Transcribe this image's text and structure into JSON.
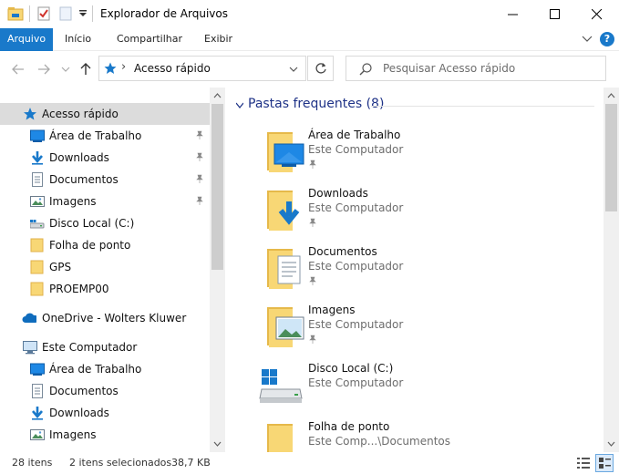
{
  "window": {
    "title": "Explorador de Arquivos",
    "controls": [
      "minimize-icon",
      "maximize-icon",
      "close-icon"
    ]
  },
  "ribbon": {
    "tabs": [
      {
        "label": "Arquivo",
        "active": true
      },
      {
        "label": "Início",
        "active": false
      },
      {
        "label": "Compartilhar",
        "active": false
      },
      {
        "label": "Exibir",
        "active": false
      }
    ],
    "help_label": "?"
  },
  "address": {
    "current": "Acesso rápido",
    "separator": "›"
  },
  "search": {
    "placeholder": "Pesquisar Acesso rápido"
  },
  "navigation": {
    "items": [
      {
        "label": "Acesso rápido",
        "icon": "star-icon",
        "pinned": false,
        "selected": true
      },
      {
        "label": "Área de Trabalho",
        "icon": "desktop-icon",
        "pinned": true
      },
      {
        "label": "Downloads",
        "icon": "download-icon",
        "pinned": true
      },
      {
        "label": "Documentos",
        "icon": "document-icon",
        "pinned": true
      },
      {
        "label": "Imagens",
        "icon": "pictures-icon",
        "pinned": true
      },
      {
        "label": "Disco Local (C:)",
        "icon": "drive-icon",
        "pinned": false
      },
      {
        "label": "Folha de ponto",
        "icon": "folder-icon",
        "pinned": false
      },
      {
        "label": "GPS",
        "icon": "folder-icon",
        "pinned": false
      },
      {
        "label": "PROEMP00",
        "icon": "folder-icon",
        "pinned": false
      },
      {
        "label": "OneDrive - Wolters Kluwer",
        "icon": "cloud-icon",
        "pinned": false
      },
      {
        "label": "Este Computador",
        "icon": "computer-icon",
        "pinned": false
      },
      {
        "label": "Área de Trabalho",
        "icon": "desktop-icon",
        "pinned": false
      },
      {
        "label": "Documentos",
        "icon": "document-icon",
        "pinned": false
      },
      {
        "label": "Downloads",
        "icon": "download-icon",
        "pinned": false
      },
      {
        "label": "Imagens",
        "icon": "pictures-icon",
        "pinned": false
      }
    ]
  },
  "content": {
    "group_title": "Pastas frequentes (8)",
    "tiles": [
      {
        "name": "Área de Trabalho",
        "location": "Este Computador",
        "icon": "desktop-folder-icon",
        "pinned": true
      },
      {
        "name": "Downloads",
        "location": "Este Computador",
        "icon": "downloads-folder-icon",
        "pinned": true
      },
      {
        "name": "Documentos",
        "location": "Este Computador",
        "icon": "documents-folder-icon",
        "pinned": true
      },
      {
        "name": "Imagens",
        "location": "Este Computador",
        "icon": "pictures-folder-icon",
        "pinned": true
      },
      {
        "name": "Disco Local (C:)",
        "location": "Este Computador",
        "icon": "local-disk-icon",
        "pinned": false
      },
      {
        "name": "Folha de ponto",
        "location": "Este Comp...\\Documentos",
        "icon": "folder-icon",
        "pinned": false
      }
    ]
  },
  "status": {
    "item_count": "28 itens",
    "selection": "2 itens selecionados",
    "size": "38,7 KB"
  },
  "colors": {
    "accent": "#1979ca",
    "header_text": "#1e3287",
    "folder": "#f8d775",
    "folder_dark": "#e6b94a",
    "selection": "#dcdcdc"
  }
}
